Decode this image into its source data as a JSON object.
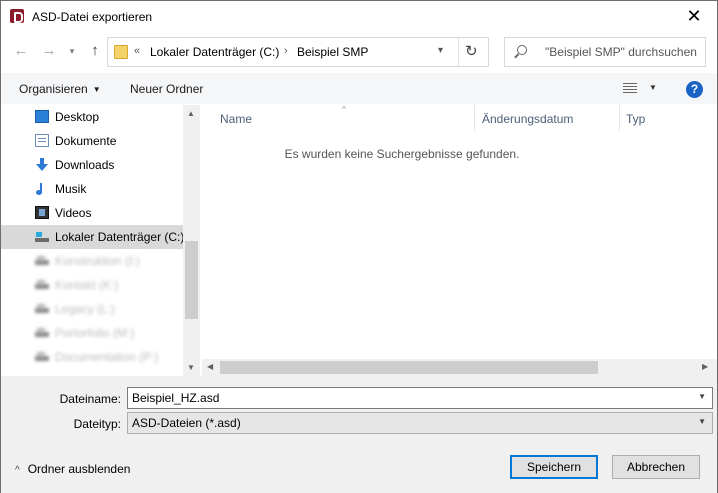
{
  "window": {
    "title": "ASD-Datei exportieren",
    "close_glyph": "✕"
  },
  "navigation": {
    "back_glyph": "←",
    "forward_glyph": "→",
    "up_glyph": "↑",
    "breadcrumb_overflow": "«",
    "breadcrumbs": [
      "Lokaler Datenträger (C:)",
      "Beispiel SMP"
    ],
    "separator": "›",
    "dropdown_glyph": "▾",
    "refresh_glyph": "↻"
  },
  "search": {
    "placeholder": "\"Beispiel SMP\" durchsuchen"
  },
  "toolbar": {
    "organize_label": "Organisieren",
    "new_folder_label": "Neuer Ordner",
    "help_glyph": "?"
  },
  "sidebar": {
    "items": [
      {
        "label": "Desktop",
        "icon": "desktop-icon"
      },
      {
        "label": "Dokumente",
        "icon": "documents-icon"
      },
      {
        "label": "Downloads",
        "icon": "downloads-icon"
      },
      {
        "label": "Musik",
        "icon": "music-icon"
      },
      {
        "label": "Videos",
        "icon": "videos-icon"
      },
      {
        "label": "Lokaler Datenträger (C:)",
        "icon": "drive-icon"
      },
      {
        "label": "Konstruktion (I:)",
        "icon": "network-drive-icon"
      },
      {
        "label": "Kontakt (K:)",
        "icon": "network-drive-icon"
      },
      {
        "label": "Legacy (L:)",
        "icon": "network-drive-icon"
      },
      {
        "label": "Portorfolio (M:)",
        "icon": "network-drive-icon"
      },
      {
        "label": "Documentation (P:)",
        "icon": "network-drive-icon"
      }
    ]
  },
  "file_list": {
    "columns": [
      "Name",
      "Änderungsdatum",
      "Typ"
    ],
    "sort_glyph": "^",
    "empty_message": "Es wurden keine Suchergebnisse gefunden."
  },
  "form": {
    "filename_label": "Dateiname:",
    "filename_value": "Beispiel_HZ.asd",
    "filetype_label": "Dateityp:",
    "filetype_value": "ASD-Dateien (*.asd)"
  },
  "footer": {
    "toggle_folders_label": "Ordner ausblenden",
    "toggle_glyph": "^",
    "save_label": "Speichern",
    "cancel_label": "Abbrechen"
  },
  "colors": {
    "accent": "#0078d7",
    "selection": "#cce8ff",
    "current": "#d9d9d9"
  }
}
